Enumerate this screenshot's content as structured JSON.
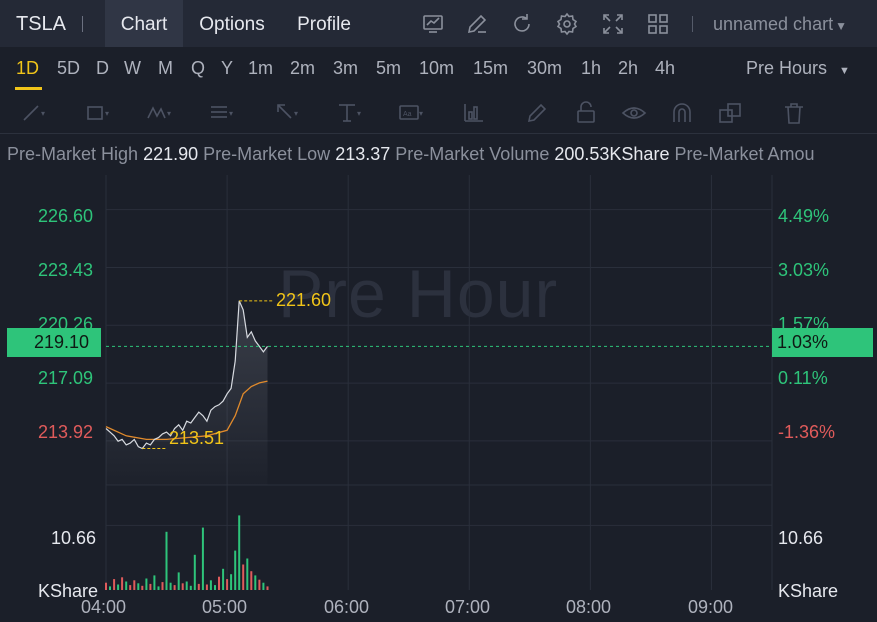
{
  "header": {
    "ticker": "TSLA",
    "tabs": [
      "Chart",
      "Options",
      "Profile"
    ],
    "active_tab": "Chart",
    "chart_name": "unnamed chart",
    "icons": [
      "indicator-icon",
      "drawing-icon",
      "refresh-icon",
      "settings-icon",
      "fullscreen-icon",
      "layout-grid-icon"
    ]
  },
  "timeframes": {
    "items": [
      "1D",
      "5D",
      "D",
      "W",
      "M",
      "Q",
      "Y",
      "1m",
      "2m",
      "3m",
      "5m",
      "10m",
      "15m",
      "30m",
      "1h",
      "2h",
      "4h"
    ],
    "active": "1D",
    "session": "Pre Hours"
  },
  "drawing_tools": [
    "trendline-icon",
    "rectangle-icon",
    "pattern-icon",
    "fibonacci-icon",
    "arrow-icon",
    "price-range-icon",
    "text-note-icon",
    "measure-icon",
    "brush-icon",
    "lock-icon",
    "eye-icon",
    "magnet-icon",
    "clone-icon",
    "trash-icon"
  ],
  "info": {
    "items": [
      {
        "label": "Pre-Market High",
        "value": "221.90"
      },
      {
        "label": "Pre-Market Low",
        "value": "213.37"
      },
      {
        "label": "Pre-Market Volume",
        "value": "200.53KShare"
      },
      {
        "label": "Pre-Market Amou",
        "value": ""
      }
    ]
  },
  "chart": {
    "watermark": "Pre Hour",
    "price_ticks": [
      "226.60",
      "223.43",
      "220.26",
      "217.09",
      "213.92"
    ],
    "percent_ticks": [
      "4.49%",
      "3.03%",
      "1.57%",
      "0.11%",
      "-1.36%"
    ],
    "current_price": "219.10",
    "current_percent": "1.03%",
    "high_annotation": "221.60",
    "low_annotation": "213.51",
    "volume_tick": "10.66",
    "volume_unit": "KShare",
    "time_ticks": [
      "04:00",
      "05:00",
      "06:00",
      "07:00",
      "08:00",
      "09:00"
    ],
    "colors": {
      "up": "#2ec47a",
      "down": "#e05b5b",
      "accent": "#f0c419",
      "avg_line": "#e08a2c",
      "price_line": "#d7dae0"
    }
  },
  "chart_data": {
    "type": "line",
    "x_range": [
      "04:00",
      "09:30"
    ],
    "ylim": [
      211.5,
      228.5
    ],
    "price": {
      "times": [
        "04:00",
        "04:02",
        "04:04",
        "04:06",
        "04:08",
        "04:10",
        "04:12",
        "04:14",
        "04:16",
        "04:18",
        "04:20",
        "04:22",
        "04:24",
        "04:26",
        "04:28",
        "04:30",
        "04:32",
        "04:34",
        "04:36",
        "04:38",
        "04:40",
        "04:42",
        "04:44",
        "04:46",
        "04:48",
        "04:50",
        "04:52",
        "04:54",
        "04:56",
        "04:58",
        "05:00",
        "05:02",
        "05:04",
        "05:06",
        "05:08",
        "05:10",
        "05:12",
        "05:14",
        "05:16",
        "05:18",
        "05:20"
      ],
      "values": [
        214.6,
        214.4,
        214.2,
        213.9,
        214.0,
        213.7,
        213.8,
        214.0,
        213.6,
        213.5,
        213.8,
        213.7,
        214.0,
        214.1,
        214.3,
        214.4,
        214.2,
        214.6,
        214.8,
        214.5,
        215.0,
        214.9,
        215.2,
        215.5,
        215.3,
        215.0,
        215.6,
        215.8,
        215.9,
        216.1,
        216.5,
        216.8,
        218.3,
        221.6,
        221.1,
        219.6,
        219.9,
        219.4,
        219.1,
        218.8,
        219.1
      ]
    },
    "average": {
      "times": [
        "04:00",
        "04:10",
        "04:20",
        "04:30",
        "04:40",
        "04:50",
        "05:00",
        "05:04",
        "05:08",
        "05:12",
        "05:16",
        "05:20"
      ],
      "values": [
        214.7,
        214.2,
        214.0,
        214.0,
        214.1,
        214.2,
        214.5,
        215.3,
        216.5,
        216.9,
        217.1,
        217.2
      ]
    },
    "volume_ylim": [
      0,
      16
    ],
    "volume": [
      {
        "time": "04:00",
        "value": 1.2,
        "dir": "down"
      },
      {
        "time": "04:02",
        "value": 0.6,
        "dir": "up"
      },
      {
        "time": "04:04",
        "value": 1.8,
        "dir": "down"
      },
      {
        "time": "04:06",
        "value": 0.9,
        "dir": "up"
      },
      {
        "time": "04:08",
        "value": 2.1,
        "dir": "down"
      },
      {
        "time": "04:10",
        "value": 1.4,
        "dir": "up"
      },
      {
        "time": "04:12",
        "value": 0.8,
        "dir": "down"
      },
      {
        "time": "04:14",
        "value": 1.6,
        "dir": "down"
      },
      {
        "time": "04:16",
        "value": 1.1,
        "dir": "up"
      },
      {
        "time": "04:18",
        "value": 0.7,
        "dir": "down"
      },
      {
        "time": "04:20",
        "value": 1.9,
        "dir": "up"
      },
      {
        "time": "04:22",
        "value": 1.0,
        "dir": "down"
      },
      {
        "time": "04:24",
        "value": 2.4,
        "dir": "up"
      },
      {
        "time": "04:26",
        "value": 0.6,
        "dir": "up"
      },
      {
        "time": "04:28",
        "value": 1.3,
        "dir": "down"
      },
      {
        "time": "04:30",
        "value": 9.6,
        "dir": "up"
      },
      {
        "time": "04:32",
        "value": 1.2,
        "dir": "up"
      },
      {
        "time": "04:34",
        "value": 0.8,
        "dir": "down"
      },
      {
        "time": "04:36",
        "value": 2.9,
        "dir": "up"
      },
      {
        "time": "04:38",
        "value": 1.1,
        "dir": "down"
      },
      {
        "time": "04:40",
        "value": 1.4,
        "dir": "up"
      },
      {
        "time": "04:42",
        "value": 0.7,
        "dir": "up"
      },
      {
        "time": "04:44",
        "value": 5.8,
        "dir": "up"
      },
      {
        "time": "04:46",
        "value": 1.0,
        "dir": "down"
      },
      {
        "time": "04:48",
        "value": 10.3,
        "dir": "up"
      },
      {
        "time": "04:50",
        "value": 0.9,
        "dir": "down"
      },
      {
        "time": "04:52",
        "value": 1.6,
        "dir": "up"
      },
      {
        "time": "04:54",
        "value": 0.8,
        "dir": "up"
      },
      {
        "time": "04:56",
        "value": 2.2,
        "dir": "down"
      },
      {
        "time": "04:58",
        "value": 3.5,
        "dir": "up"
      },
      {
        "time": "05:00",
        "value": 1.8,
        "dir": "down"
      },
      {
        "time": "05:02",
        "value": 2.6,
        "dir": "up"
      },
      {
        "time": "05:04",
        "value": 6.5,
        "dir": "up"
      },
      {
        "time": "05:06",
        "value": 12.3,
        "dir": "up"
      },
      {
        "time": "05:08",
        "value": 4.2,
        "dir": "down"
      },
      {
        "time": "05:10",
        "value": 5.2,
        "dir": "up"
      },
      {
        "time": "05:12",
        "value": 3.1,
        "dir": "down"
      },
      {
        "time": "05:14",
        "value": 2.4,
        "dir": "up"
      },
      {
        "time": "05:16",
        "value": 1.7,
        "dir": "down"
      },
      {
        "time": "05:18",
        "value": 1.2,
        "dir": "up"
      },
      {
        "time": "05:20",
        "value": 0.6,
        "dir": "down"
      }
    ]
  }
}
